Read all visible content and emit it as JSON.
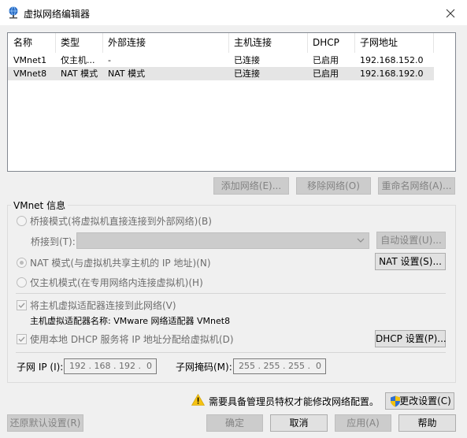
{
  "window": {
    "title": "虚拟网络编辑器"
  },
  "table": {
    "columns": [
      "名称",
      "类型",
      "外部连接",
      "主机连接",
      "DHCP",
      "子网地址"
    ],
    "rows": [
      [
        "VMnet1",
        "仅主机...",
        "-",
        "已连接",
        "已启用",
        "192.168.152.0"
      ],
      [
        "VMnet8",
        "NAT 模式",
        "NAT 模式",
        "已连接",
        "已启用",
        "192.168.192.0"
      ]
    ],
    "selected_row": 1
  },
  "list_buttons": {
    "add": "添加网络(E)...",
    "remove": "移除网络(O)",
    "rename": "重命名网络(A)..."
  },
  "vmnet_info": {
    "group_title": "VMnet 信息",
    "bridged_label": "桥接模式(将虚拟机直接连接到外部网络)(B)",
    "bridged_to_label": "桥接到(T):",
    "auto_settings": "自动设置(U)...",
    "nat_label": "NAT 模式(与虚拟机共享主机的 IP 地址)(N)",
    "nat_settings": "NAT 设置(S)...",
    "hostonly_label": "仅主机模式(在专用网络内连接虚拟机)(H)",
    "connect_adapter_label": "将主机虚拟适配器连接到此网络(V)",
    "adapter_name_label": "主机虚拟适配器名称: VMware 网络适配器 VMnet8",
    "dhcp_label": "使用本地 DHCP 服务将 IP 地址分配给虚拟机(D)",
    "dhcp_settings": "DHCP 设置(P)...",
    "subnet_ip_label": "子网 IP (I):",
    "subnet_ip_value": "192 . 168 . 192 .  0",
    "subnet_mask_label": "子网掩码(M):",
    "subnet_mask_value": "255 . 255 . 255 .  0"
  },
  "footer": {
    "admin_warning": "需要具备管理员特权才能修改网络配置。",
    "change_settings": "更改设置(C)",
    "restore_defaults": "还原默认设置(R)",
    "ok": "确定",
    "cancel": "取消",
    "apply": "应用(A)",
    "help": "帮助"
  },
  "icons": {
    "title": "network-globe-icon",
    "close": "close-icon",
    "warning": "warning-icon",
    "shield": "uac-shield-icon",
    "dropdown": "chevron-down-icon"
  },
  "colors": {
    "window_bg": "#f0f0f0",
    "selected_row_bg": "#e5e5e5",
    "disabled_text": "#838383",
    "focus_border": "#0078d7"
  }
}
